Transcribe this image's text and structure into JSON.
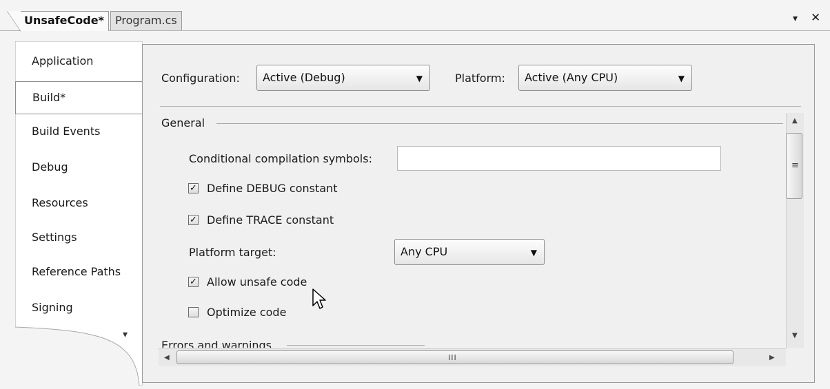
{
  "tabs": [
    {
      "label": "UnsafeCode*",
      "active": true
    },
    {
      "label": "Program.cs",
      "active": false
    }
  ],
  "window_controls": {
    "dropdown_glyph": "▾",
    "close_glyph": "✕"
  },
  "nav": {
    "items": [
      {
        "label": "Application"
      },
      {
        "label": "Build*",
        "active": true
      },
      {
        "label": "Build Events"
      },
      {
        "label": "Debug"
      },
      {
        "label": "Resources"
      },
      {
        "label": "Settings"
      },
      {
        "label": "Reference Paths"
      },
      {
        "label": "Signing"
      }
    ],
    "more_glyph": "▾"
  },
  "config": {
    "configuration_label": "Configuration:",
    "configuration_value": "Active (Debug)",
    "platform_label": "Platform:",
    "platform_value": "Active (Any CPU)"
  },
  "general": {
    "heading": "General",
    "symbols_label": "Conditional compilation symbols:",
    "symbols_value": "",
    "define_debug": {
      "label": "Define DEBUG constant",
      "checked": true
    },
    "define_trace": {
      "label": "Define TRACE constant",
      "checked": true
    },
    "platform_target_label": "Platform target:",
    "platform_target_value": "Any CPU",
    "allow_unsafe": {
      "label": "Allow unsafe code",
      "checked": true
    },
    "optimize": {
      "label": "Optimize code",
      "checked": false
    }
  },
  "next_section_heading": "Errors and warnings",
  "scrollbars": {
    "up": "▲",
    "down": "▼",
    "left": "◀",
    "right": "▶",
    "v_grip": "≡",
    "h_grip": "III"
  },
  "colors": {
    "accent_border": "#9b9b9b",
    "panel_bg": "#f0f0f0"
  }
}
